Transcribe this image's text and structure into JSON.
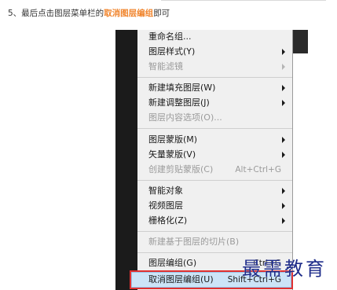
{
  "instruction": {
    "prefix": "5、最后点击图层菜单栏的",
    "highlight": "取消图层编组",
    "suffix": "即可"
  },
  "menu": {
    "items": [
      {
        "label": "重命名组...",
        "shortcut": "",
        "submenu": false,
        "disabled": false
      },
      {
        "label": "图层样式(Y)",
        "shortcut": "",
        "submenu": true,
        "disabled": false
      },
      {
        "label": "智能滤镜",
        "shortcut": "",
        "submenu": true,
        "disabled": true
      },
      {
        "label": "新建填充图层(W)",
        "shortcut": "",
        "submenu": true,
        "disabled": false
      },
      {
        "label": "新建调整图层(J)",
        "shortcut": "",
        "submenu": true,
        "disabled": false
      },
      {
        "label": "图层内容选项(O)...",
        "shortcut": "",
        "submenu": false,
        "disabled": true
      },
      {
        "label": "图层蒙版(M)",
        "shortcut": "",
        "submenu": true,
        "disabled": false
      },
      {
        "label": "矢量蒙版(V)",
        "shortcut": "",
        "submenu": true,
        "disabled": false
      },
      {
        "label": "创建剪贴蒙版(C)",
        "shortcut": "Alt+Ctrl+G",
        "submenu": false,
        "disabled": true
      },
      {
        "label": "智能对象",
        "shortcut": "",
        "submenu": true,
        "disabled": false
      },
      {
        "label": "视频图层",
        "shortcut": "",
        "submenu": true,
        "disabled": false
      },
      {
        "label": "栅格化(Z)",
        "shortcut": "",
        "submenu": true,
        "disabled": false
      },
      {
        "label": "新建基于图层的切片(B)",
        "shortcut": "",
        "submenu": false,
        "disabled": true
      },
      {
        "label": "图层编组(G)",
        "shortcut": "Ctrl+G",
        "submenu": false,
        "disabled": false
      },
      {
        "label": "取消图层编组(U)",
        "shortcut": "Shift+Ctrl+G",
        "submenu": false,
        "disabled": false,
        "highlighted": true
      }
    ]
  },
  "watermark": "最需教育",
  "colors": {
    "highlight_text": "#f0832a",
    "menu_bg": "#f0f0f0",
    "selection_bg": "#cce4f7",
    "selection_outline": "#e03131",
    "watermark": "#1f2d8a"
  }
}
